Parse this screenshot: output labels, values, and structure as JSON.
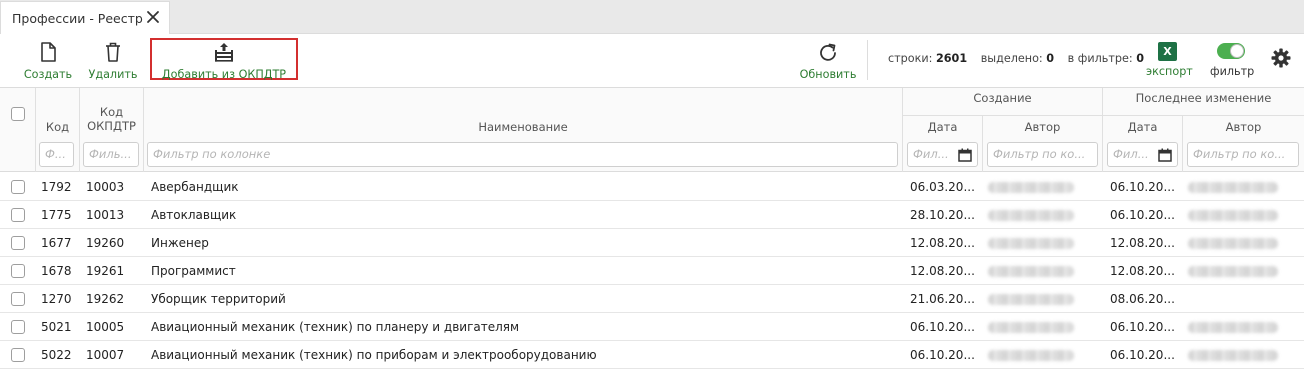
{
  "tab": {
    "title": "Профессии - Реестр"
  },
  "toolbar": {
    "create_label": "Создать",
    "delete_label": "Удалить",
    "add_okpdtr_label": "Добавить из ОКПДТР",
    "refresh_label": "Обновить",
    "export_label": "экспорт",
    "filter_label": "фильтр",
    "excel_glyph": "X"
  },
  "stats": {
    "rows_label": "строки:",
    "rows_value": "2601",
    "selected_label": "выделено:",
    "selected_value": "0",
    "in_filter_label": "в фильтре:",
    "in_filter_value": "0"
  },
  "columns": {
    "code": "Код",
    "okpdtr_line1": "Код",
    "okpdtr_line2": "ОКПДТР",
    "name": "Наименование",
    "created_group": "Создание",
    "modified_group": "Последнее изменение",
    "date": "Дата",
    "author": "Автор"
  },
  "filters": {
    "code": "Ф...",
    "okpdtr": "Филь...",
    "name": "Фильтр по колонке",
    "created_date": "Фил...",
    "created_author": "Фильтр по ко...",
    "modified_date": "Фил...",
    "modified_author": "Фильтр по ко..."
  },
  "rows": [
    {
      "code": "1792",
      "okpdtr": "10003",
      "name": "Авербандщик",
      "created": "06.03.20...",
      "modified": "06.10.20..."
    },
    {
      "code": "1775",
      "okpdtr": "10013",
      "name": "Автоклавщик",
      "created": "28.10.20...",
      "modified": "06.10.20..."
    },
    {
      "code": "1677",
      "okpdtr": "19260",
      "name": "Инженер",
      "created": "12.08.20...",
      "modified": "12.08.20..."
    },
    {
      "code": "1678",
      "okpdtr": "19261",
      "name": "Программист",
      "created": "12.08.20...",
      "modified": "12.08.20..."
    },
    {
      "code": "1270",
      "okpdtr": "19262",
      "name": "Уборщик территорий",
      "created": "21.06.20...",
      "modified": "08.06.20..."
    },
    {
      "code": "5021",
      "okpdtr": "10005",
      "name": "Авиационный механик (техник) по планеру и двигателям",
      "created": "06.10.20...",
      "modified": "06.10.20..."
    },
    {
      "code": "5022",
      "okpdtr": "10007",
      "name": "Авиационный механик (техник) по приборам и электрооборудованию",
      "created": "06.10.20...",
      "modified": "06.10.20..."
    }
  ],
  "colors": {
    "accent_green": "#2e7d32",
    "highlight_red": "#d32f2f",
    "toggle_on": "#4caf50",
    "excel_green": "#1e7145"
  }
}
